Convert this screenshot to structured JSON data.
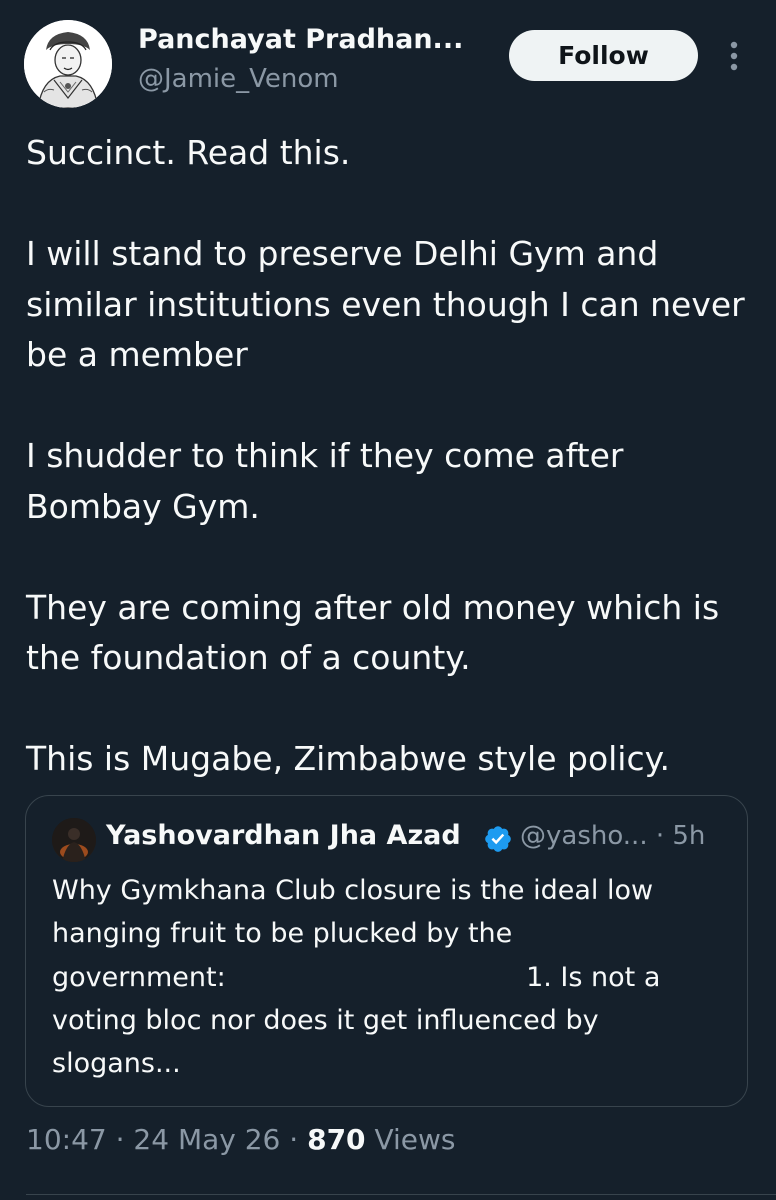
{
  "author": {
    "display_name": "Panchayat Pradhan...",
    "handle": "@Jamie_Venom",
    "avatar_icon": "portrait-sketch-avatar"
  },
  "follow_label": "Follow",
  "tweet": {
    "paragraphs": [
      "Succinct. Read this.",
      "I will stand to preserve Delhi Gym and similar institutions even though I can never be a member",
      "I shudder to think if they come after Bombay Gym.",
      "They are coming after old money which is the foundation of a county.",
      "This is Mugabe, Zimbabwe style policy."
    ]
  },
  "quoted_tweet": {
    "display_name": "Yashovardhan Jha Azad",
    "verified_icon": "verified-badge-icon",
    "handle": "@yasho...",
    "separator": "·",
    "age": "5h",
    "lines": [
      "Why Gymkhana Club closure is the ideal low",
      "hanging fruit to be plucked by the",
      "government:                                   1. Is not a",
      "voting bloc nor does it get influenced by",
      "slogans..."
    ]
  },
  "meta": {
    "time": "10:47",
    "sep1": "·",
    "date": "24 May 26",
    "sep2": "·",
    "views_count": "870",
    "views_label": "Views"
  },
  "colors": {
    "background": "#15202b",
    "text": "#f7f9f9",
    "secondary_text": "#8b98a5",
    "border": "#38444d",
    "verified": "#1d9bf0",
    "button_bg": "#eff3f4"
  }
}
